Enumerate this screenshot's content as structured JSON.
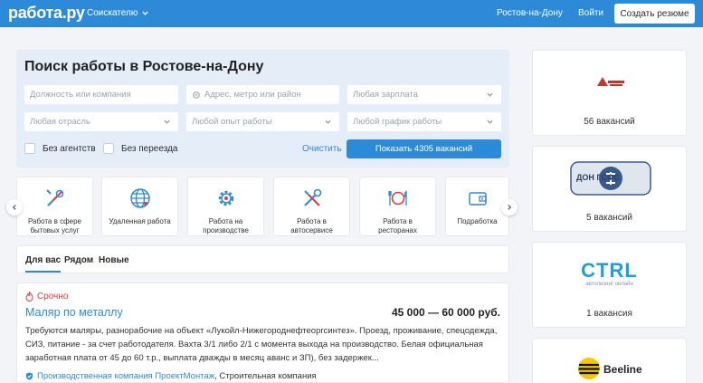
{
  "header": {
    "logo": "работа.ру",
    "role": "Соискателю",
    "city": "Ростов-на-Дону",
    "login": "Войти",
    "create_resume": "Создать резюме"
  },
  "search": {
    "title": "Поиск работы в Ростове-на-Дону",
    "position_placeholder": "Должность или компания",
    "address_placeholder": "Адрес, метро или район",
    "salary": "Любая зарплата",
    "industry": "Любая отрасль",
    "experience": "Любой опыт работы",
    "schedule": "Любой график работы",
    "no_agencies": "Без агентств",
    "no_relocation": "Без переезда",
    "clear": "Очистить",
    "show_button": "Показать 4305 вакансий"
  },
  "categories": [
    {
      "label": "Работа в сфере бытовых услуг",
      "icon": "tools-icon"
    },
    {
      "label": "Удаленная работа",
      "icon": "globe-icon"
    },
    {
      "label": "Работа на производстве",
      "icon": "gear-icon"
    },
    {
      "label": "Работа в автосервисе",
      "icon": "wrench-icon"
    },
    {
      "label": "Работа в ресторанах",
      "icon": "plate-icon"
    },
    {
      "label": "Подработка",
      "icon": "wallet-icon"
    }
  ],
  "tabs": [
    "Для вас",
    "Рядом",
    "Новые"
  ],
  "vacancy": {
    "badge": "Срочно",
    "title": "Маляр по металлу",
    "salary": "45 000 — 60 000 руб.",
    "description": "Требуются маляры, разнорабочие на объект «Лукойл-Нижегороднефтеоргсинтез». Проезд, проживание, спецодежда, СИЗ, питание - за счет работодателя. Вахта 3/1 либо 2/1 с момента выхода на производство. Белая официальная заработная плата от 45 до 60 т.р., выплата дважды в месяц аванс и ЗП), без задержек...",
    "company": "Производственная компания ПроектМонтаж",
    "industry": ", Строительная компания"
  },
  "employers": [
    {
      "count": "56 вакансий"
    },
    {
      "count": "5 вакансий",
      "logo_text": "ДОН ГСФС"
    },
    {
      "count": "1 вакансия",
      "logo_text": "CTRL",
      "logo_sub": "автолизинг онлайн"
    },
    {
      "logo_text": "Beeline"
    }
  ],
  "colors": {
    "brand": "#2c8ad8",
    "urgent": "#e23b3b",
    "beeline_yellow": "#f7c600"
  }
}
